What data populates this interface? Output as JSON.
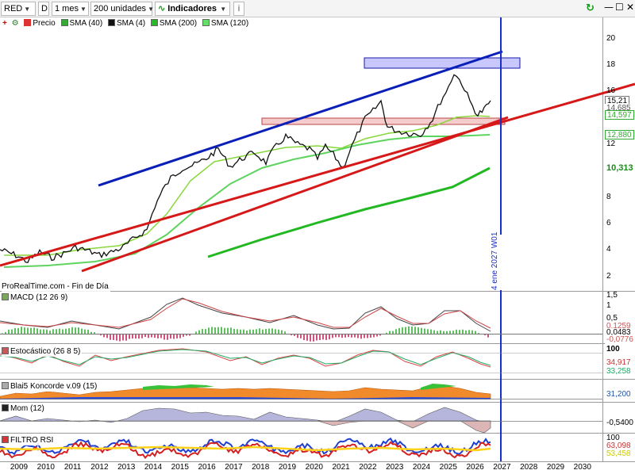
{
  "toolbar": {
    "symbol": "RED",
    "d_button": "D",
    "timeframe": "1 mes",
    "units": "200 unidades",
    "indicators": "Indicadores",
    "info": "i"
  },
  "legend": {
    "price": "Precio",
    "sma1": "SMA (40)",
    "sma2": "SMA (4)",
    "sma3": "SMA (200)",
    "sma4": "SMA (120)"
  },
  "colors": {
    "price_up": "#000000",
    "sma40": "#88d83a",
    "sma4": "#000000",
    "sma200": "#2eb82e",
    "sma120": "#5fd35f",
    "trend_blue": "#0a1fb8",
    "trend_red": "#d61818",
    "vline": "#1a2fc8"
  },
  "main": {
    "watermark": "ProRealTime.com - Fin de Día",
    "vline_label": "4 ene 2027 W01",
    "y_ticks": [
      "20",
      "18",
      "16",
      "14",
      "12",
      "10",
      "8",
      "6",
      "4",
      "2"
    ],
    "tags": {
      "price": "15,21",
      "p2": "14,685",
      "p3": "14,597",
      "p4": "12,880",
      "p5": "10,313"
    }
  },
  "macd": {
    "label": "MACD (12 26 9)",
    "ticks": [
      "1,5",
      "1",
      "0,5",
      "0"
    ],
    "tags": {
      "a": "0,1259",
      "b": "0,0483",
      "c": "-0,0776"
    }
  },
  "stoch": {
    "label": "Estocástico (26 8 5)",
    "ticks": [
      "100"
    ],
    "tags": {
      "a": "34,917",
      "b": "33,258"
    }
  },
  "blai": {
    "label": "Blai5 Koncorde v.09 (15)",
    "tags": {
      "a": "31,200"
    }
  },
  "mom": {
    "label": "Mom (12)",
    "tags": {
      "a": "-0,5400"
    }
  },
  "rsi": {
    "label": "FILTRO RSI",
    "ticks": [
      "100"
    ],
    "tags": {
      "a": "63,098",
      "b": "53,458"
    }
  },
  "x_axis": [
    "2009",
    "2010",
    "2011",
    "2012",
    "2013",
    "2014",
    "2015",
    "2016",
    "2017",
    "2018",
    "2019",
    "2020",
    "2021",
    "2022",
    "2023",
    "2024",
    "2025",
    "2026",
    "2027",
    "2028",
    "2029",
    "2030"
  ]
}
